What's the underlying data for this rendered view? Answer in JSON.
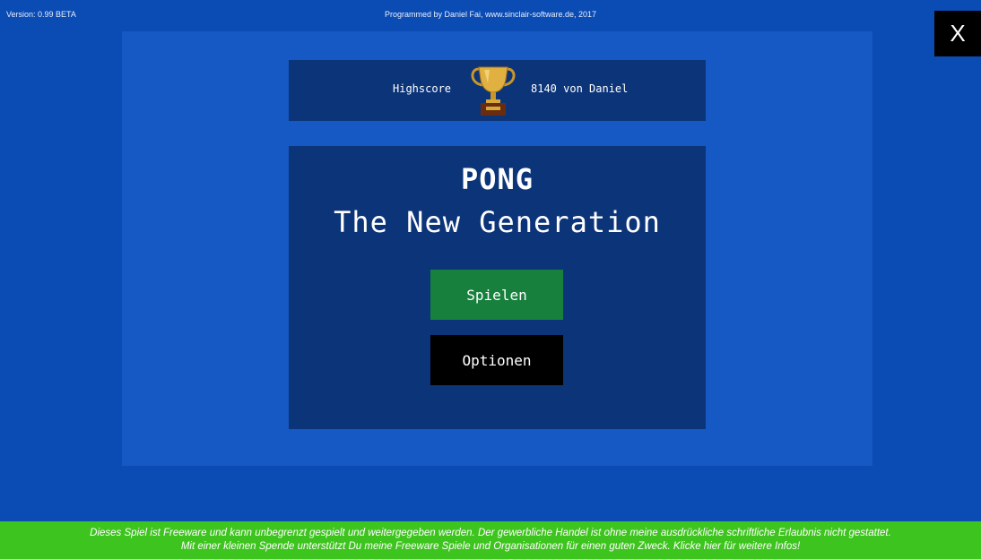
{
  "header": {
    "version": "Version: 0.99 BETA",
    "credits": "Programmed by Daniel Fai, www.sinclair-software.de, 2017",
    "close_label": "X"
  },
  "highscore": {
    "label": "Highscore",
    "value": "8140 von Daniel",
    "icon": "trophy-icon"
  },
  "menu": {
    "title_line1": "PONG",
    "title_line2": "The New Generation",
    "play_label": "Spielen",
    "options_label": "Optionen"
  },
  "footer": {
    "line1": "Dieses Spiel ist Freeware und kann unbegrenzt gespielt und weitergegeben werden. Der gewerbliche Handel ist ohne meine ausdrückliche schriftliche Erlaubnis nicht gestattet.",
    "line2": "Mit einer kleinen Spende unterstützt Du meine Freeware Spiele und Organisationen für einen guten Zweck. Klicke hier für weitere Infos!"
  },
  "colors": {
    "background": "#0a4cb4",
    "stage": "#1658c4",
    "panel": "#0c3478",
    "play_button": "#16803c",
    "options_button": "#000000",
    "footer": "#3ec41e"
  }
}
